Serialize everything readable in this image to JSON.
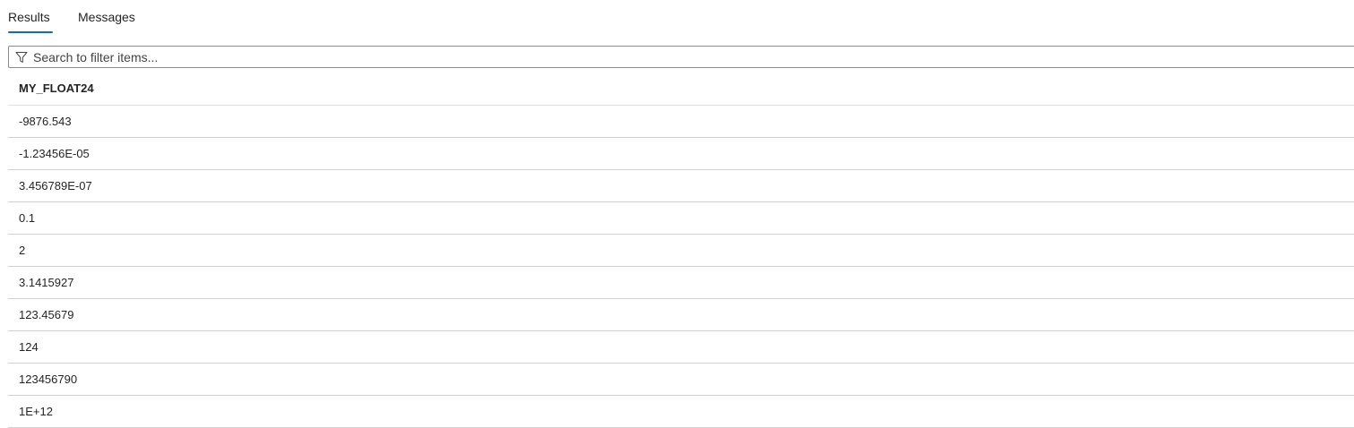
{
  "tabs": [
    {
      "label": "Results",
      "active": true
    },
    {
      "label": "Messages",
      "active": false
    }
  ],
  "filter": {
    "placeholder": "Search to filter items...",
    "value": ""
  },
  "grid": {
    "columns": [
      "MY_FLOAT24"
    ],
    "rows": [
      "-9876.543",
      "-1.23456E-05",
      "3.456789E-07",
      "0.1",
      "2",
      "3.1415927",
      "123.45679",
      "124",
      "123456790",
      "1E+12"
    ]
  },
  "colors": {
    "accent": "#0f6cbd"
  }
}
